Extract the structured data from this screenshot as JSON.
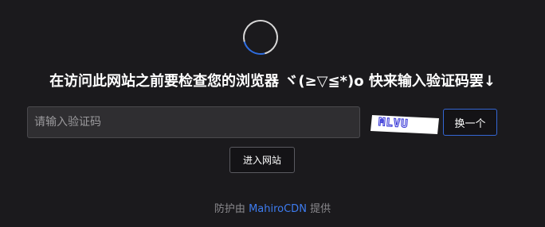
{
  "status": {
    "spinner_icon": "loading-spinner-icon"
  },
  "headline": "在访问此网站之前要检查您的浏览器 ヾ(≥▽≦*)o 快来输入验证码罢↓",
  "captcha": {
    "input_placeholder": "请输入验证码",
    "input_value": "",
    "image_text": "MLVU",
    "refresh_label": "换一个"
  },
  "submit_label": "进入网站",
  "footer": {
    "prefix": "防护由",
    "brand": "MahiroCDN",
    "suffix": "提供"
  },
  "colors": {
    "background": "#1b1a1d",
    "accent": "#3466d4",
    "brand": "#3d7cf0"
  }
}
